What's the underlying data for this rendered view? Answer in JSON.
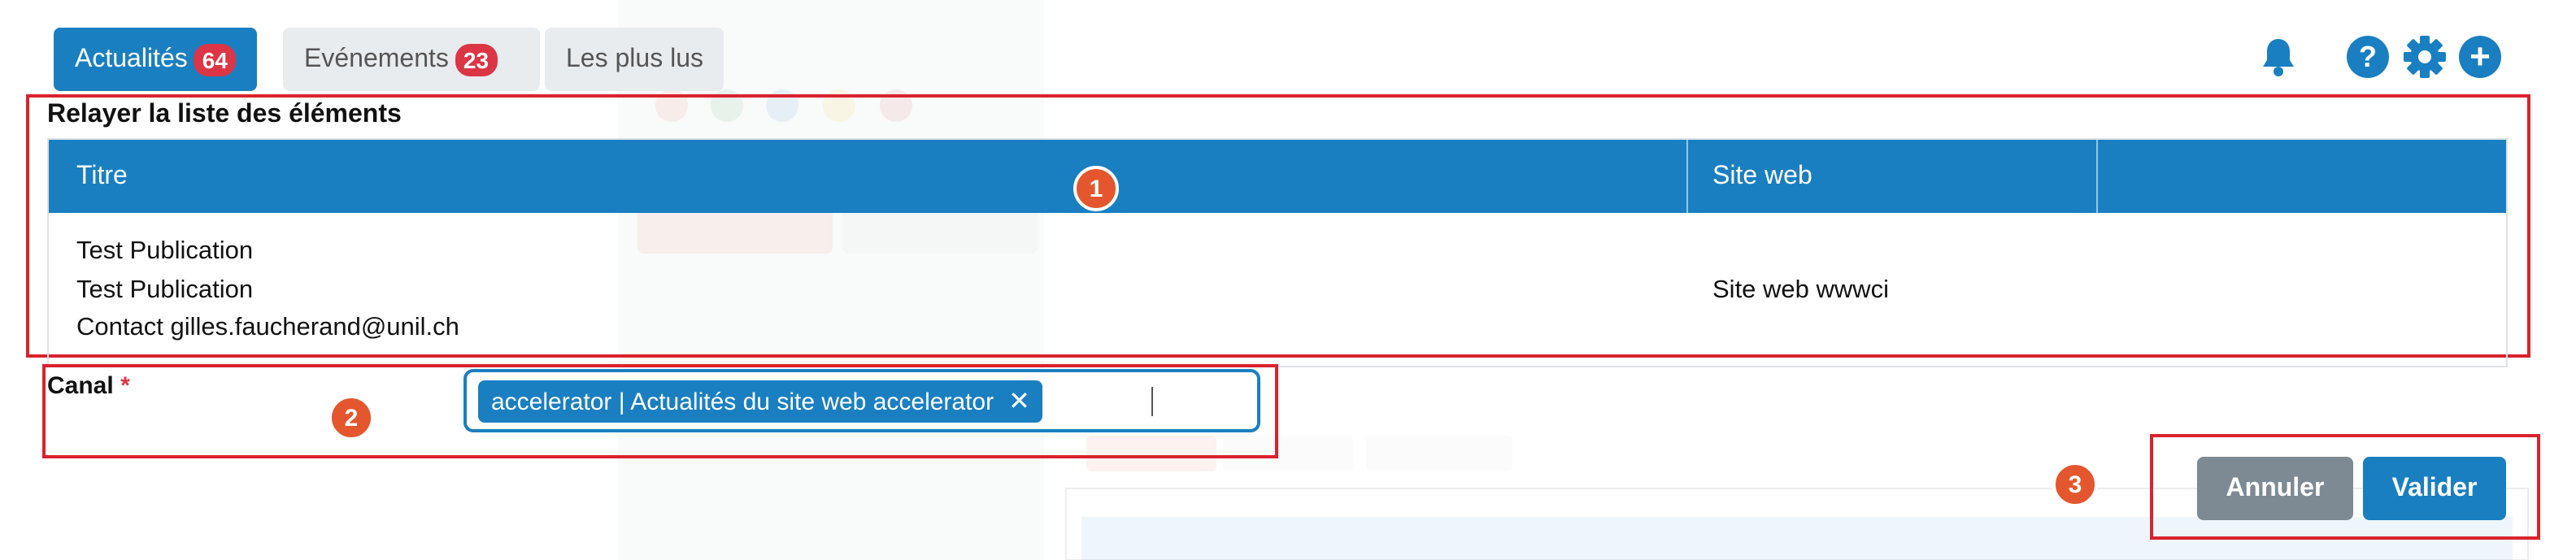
{
  "tabs": [
    {
      "label": "Actualités",
      "count": "64",
      "active": true
    },
    {
      "label": "Evénements",
      "count": "23",
      "active": false
    },
    {
      "label": "Les plus lus",
      "count": "",
      "active": false
    }
  ],
  "header_icons": [
    {
      "icon": "bell-icon",
      "label": ""
    },
    {
      "icon": "help-icon",
      "label": "?"
    },
    {
      "icon": "gear-icon",
      "label": ""
    },
    {
      "icon": "add-icon",
      "label": "+"
    }
  ],
  "relay": {
    "title": "Relayer la liste des éléments",
    "columns": [
      "Titre",
      "Site web",
      ""
    ],
    "rows": [
      {
        "title_lines": [
          "Test Publication",
          "Test Publication",
          "Contact gilles.faucherand@unil.ch"
        ],
        "site": "Site web wwwci",
        "extra": ""
      }
    ]
  },
  "canal": {
    "label": "Canal",
    "required_mark": "*",
    "selected": "accelerator | Actualités du site web accelerator",
    "remove_glyph": "✕"
  },
  "actions": {
    "cancel": "Annuler",
    "submit": "Valider"
  },
  "callouts": [
    "1",
    "2",
    "3"
  ],
  "colors": {
    "primary": "#1a7fc1",
    "badge": "#dc3545",
    "highlight_box": "#d9232d",
    "callout": "#e4572e",
    "cancel": "#7d8a94"
  }
}
